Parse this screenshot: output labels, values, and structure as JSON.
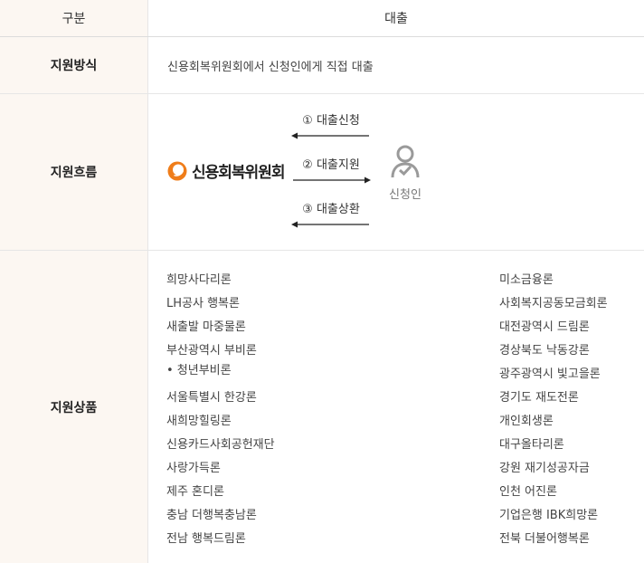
{
  "header": {
    "col1": "구분",
    "col2": "대출"
  },
  "rows": {
    "method": {
      "label": "지원방식",
      "text": "신용회복위원회에서 신청인에게 직접 대출"
    },
    "flow": {
      "label": "지원흐름",
      "org_name": "신용회복위원회",
      "steps": [
        "① 대출신청",
        "② 대출지원",
        "③ 대출상환"
      ],
      "person_label": "신청인"
    },
    "products": {
      "label": "지원상품",
      "left": [
        "희망사다리론",
        "LH공사 행복론",
        "새출발 마중물론",
        "부산광역시 부비론",
        "• 청년부비론",
        "서울특별시 한강론",
        "새희망힐링론",
        "신용카드사회공헌재단",
        "사랑가득론",
        "제주 혼디론",
        "충남 더행복충남론",
        "전남 행복드림론"
      ],
      "right": [
        "미소금융론",
        "사회복지공동모금회론",
        "대전광역시 드림론",
        "경상북도 낙동강론",
        "광주광역시 빛고을론",
        "경기도 재도전론",
        "개인회생론",
        "대구올타리론",
        "강원 재기성공자금",
        "인천 어진론",
        "기업은행 IBK희망론",
        "전북 더불어행복론"
      ]
    }
  },
  "colors": {
    "label_bg": "#fcf7f2",
    "logo_orange": "#ef7d1a",
    "border": "#e6e6e6"
  }
}
